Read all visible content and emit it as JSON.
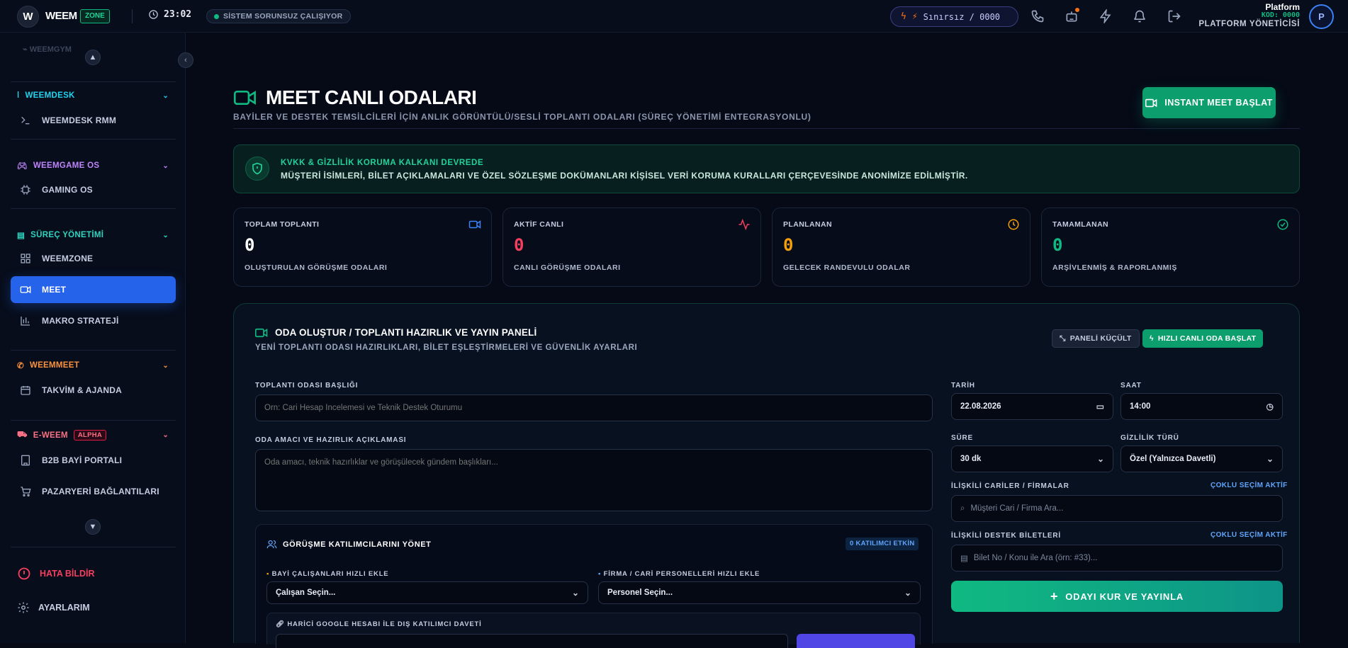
{
  "topbar": {
    "logo_letter": "W",
    "logo_text": "WEEM",
    "logo_badge": "ZONE",
    "time": "23:02",
    "status": "SİSTEM SORUNSUZ ÇALIŞIYOR",
    "credit": "Sınırsız / 0000",
    "user_name": "Platform",
    "user_code": "KOD: 0000",
    "user_role": "PLATFORM YÖNETİCİSİ",
    "avatar_letter": "P"
  },
  "sidebar": {
    "faded_item": "WEEMGYM",
    "groups": {
      "weemdesk": "WEEMDESK",
      "weemgame": "WEEMGAME OS",
      "surec": "SÜREÇ YÖNETİMİ",
      "weemmeet": "WEEMMEET",
      "eweem": "E-WEEM",
      "eweem_badge": "ALPHA"
    },
    "items": {
      "rmm": "WEEMDESK RMM",
      "gaming": "GAMING OS",
      "weemzone": "WEEMZONE",
      "meet": "MEET",
      "makro": "MAKRO STRATEJİ",
      "takvim": "TAKVİM & AJANDA",
      "b2b": "B2B BAYİ PORTALI",
      "pazaryeri": "PAZARYERİ BAĞLANTILARI"
    },
    "bottom": {
      "report": "HATA BİLDİR",
      "settings": "AYARLARIM"
    },
    "colors": {
      "weemdesk": "#22d3ee",
      "weemgame": "#c084fc",
      "surec": "#2dd4bf",
      "weemmeet": "#fb923c",
      "eweem": "#fb7185"
    }
  },
  "main": {
    "title": "MEET CANLI ODALARI",
    "subtitle": "BAYİLER VE DESTEK TEMSİLCİLERİ İÇİN ANLIK GÖRÜNTÜLÜ/SESLİ TOPLANTI ODALARI (SÜREÇ YÖNETİMİ ENTEGRASYONLU)",
    "instant_button": "INSTANT MEET BAŞLAT",
    "kvkk_title": "KVKK & GİZLİLİK KORUMA KALKANI DEVREDE",
    "kvkk_desc": "MÜŞTERİ İSİMLERİ, BİLET AÇIKLAMALARI VE ÖZEL SÖZLEŞME DOKÜMANLARI KİŞİSEL VERİ KORUMA KURALLARI ÇERÇEVESİNDE ANONİMİZE EDİLMİŞTİR.",
    "stats": [
      {
        "label": "TOPLAM TOPLANTI",
        "value": "0",
        "sub": "OLUŞTURULAN GÖRÜŞME ODALARI",
        "color": "#ffffff",
        "icon": "video-icon",
        "icon_color": "#3b82f6"
      },
      {
        "label": "AKTİF CANLI",
        "value": "0",
        "sub": "CANLI GÖRÜŞME ODALARI",
        "color": "#f43f5e",
        "icon": "activity-icon",
        "icon_color": "#f43f5e"
      },
      {
        "label": "PLANLANAN",
        "value": "0",
        "sub": "GELECEK RANDEVULU ODALAR",
        "color": "#f59e0b",
        "icon": "clock-icon",
        "icon_color": "#f59e0b"
      },
      {
        "label": "TAMAMLANAN",
        "value": "0",
        "sub": "ARŞİVLENMİŞ & RAPORLANMIŞ",
        "color": "#10b981",
        "icon": "check-circle-icon",
        "icon_color": "#10b981"
      }
    ]
  },
  "panel": {
    "title": "ODA OLUŞTUR / TOPLANTI HAZIRLIK VE YAYIN PANELİ",
    "subtitle": "YENİ TOPLANTI ODASI HAZIRLIKLARI, BİLET EŞLEŞTİRMELERİ VE GÜVENLİK AYARLARI",
    "shrink_button": "PANELİ KÜÇÜLT",
    "quick_button": "HIZLI CANLI ODA BAŞLAT",
    "room_title_label": "TOPLANTI ODASI BAŞLIĞI",
    "room_title_placeholder": "Örn: Cari Hesap İncelemesi ve Teknik Destek Oturumu",
    "purpose_label": "ODA AMACI VE HAZIRLIK AÇIKLAMASI",
    "purpose_placeholder": "Oda amacı, teknik hazırlıklar ve görüşülecek gündem başlıkları...",
    "date_label": "TARİH",
    "date_value": "22.08.2026",
    "time_label": "SAAT",
    "time_value": "14:00",
    "duration_label": "SÜRE",
    "duration_value": "30 dk",
    "privacy_label": "GİZLİLİK TÜRÜ",
    "privacy_value": "Özel (Yalnızca Davetli)",
    "related_label": "İLİŞKİLİ CARİLER / FİRMALAR",
    "related_multi": "ÇOKLU SEÇİM AKTİF",
    "related_placeholder": "Müşteri Cari / Firma Ara...",
    "tickets_label": "İLİŞKİLİ DESTEK BİLETLERİ",
    "tickets_multi": "ÇOKLU SEÇİM AKTİF",
    "tickets_placeholder": "Bilet No / Konu ile Ara (örn: #33)...",
    "publish_button": "ODAYI KUR VE YAYINLA",
    "participants": {
      "title": "GÖRÜŞME KATILIMCILARINI YÖNET",
      "badge": "0 KATILIMCI ETKİN",
      "dealer_label": "BAYİ ÇALIŞANLARI HIZLI EKLE",
      "dealer_value": "Çalışan Seçin...",
      "firm_label": "FİRMA / CARİ PERSONELLERİ HIZLI EKLE",
      "firm_value": "Personel Seçin...",
      "google_label": "HARİCİ GOOGLE HESABI İLE DIŞ KATILIMCI DAVETİ"
    }
  }
}
